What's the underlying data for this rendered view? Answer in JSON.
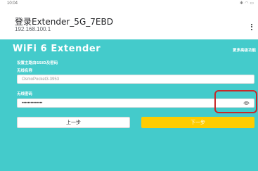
{
  "status_bar": {
    "time": "10:04",
    "icons": [
      "bluetooth-icon",
      "wifi-icon",
      "battery-icon"
    ]
  },
  "header": {
    "title": "登录Extender_5G_7EBD",
    "subtitle": "192.168.100.1",
    "menu_icon": "more-vert-icon"
  },
  "page": {
    "brand_title": "WiFi 6 Extender",
    "advanced_link": "更多高级功能",
    "section_heading": "设置主路由SSID及密码",
    "ssid_label": "无线名称",
    "ssid_value": "OsmoPocket3-3953",
    "password_label": "无线密码",
    "password_value": "••••••••••••••",
    "eye_icon": "eye-icon",
    "prev_button": "上一步",
    "next_button": "下一步"
  },
  "colors": {
    "page_background": "#44cbcb",
    "next_button": "#ffcc00",
    "highlight": "#c62828"
  }
}
